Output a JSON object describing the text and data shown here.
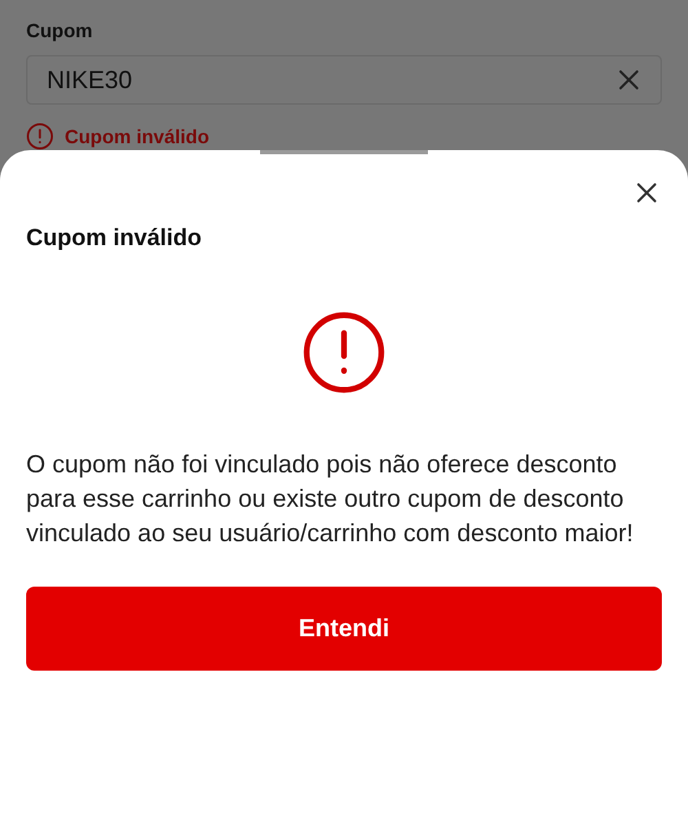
{
  "form": {
    "label": "Cupom",
    "value": "NIKE30",
    "error": "Cupom inválido"
  },
  "dialog": {
    "title": "Cupom inválido",
    "message": "O cupom não foi vinculado pois não oferece desconto para esse carrinho ou existe outro cupom de desconto vinculado ao seu usuário/carrinho com desconto maior!",
    "button": "Entendi"
  }
}
